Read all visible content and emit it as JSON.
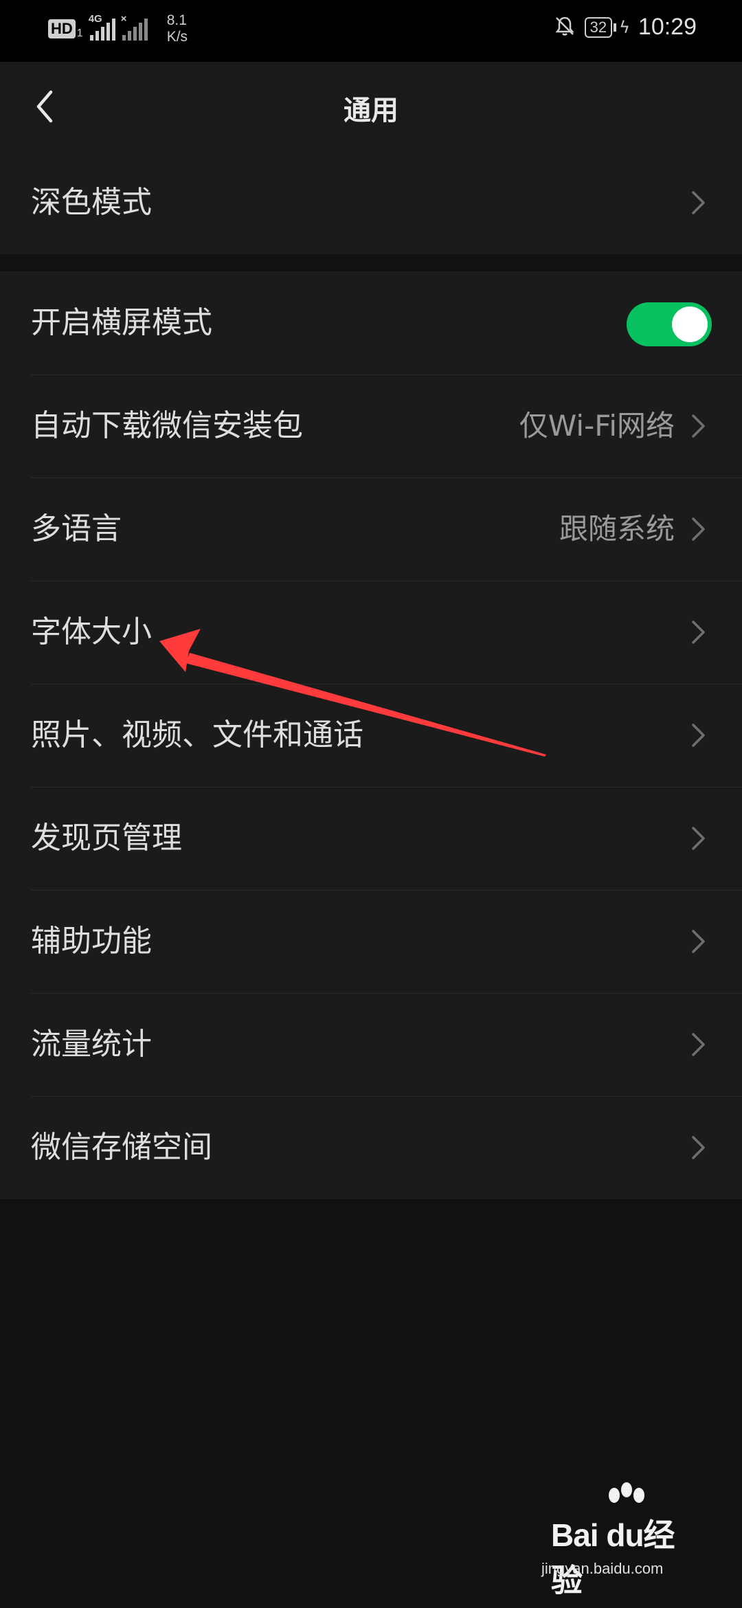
{
  "status_bar": {
    "hd_label": "HD",
    "sim_label": "1",
    "signal_tag_1": "4G",
    "signal_tag_2": "×",
    "speed_value": "8.1",
    "speed_unit": "K/s",
    "battery_level": "32",
    "time": "10:29"
  },
  "header": {
    "title": "通用"
  },
  "section1": {
    "items": [
      {
        "label": "深色模式",
        "value": ""
      }
    ]
  },
  "section2": {
    "landscape": {
      "label": "开启横屏模式",
      "enabled": true
    },
    "items": [
      {
        "label": "自动下载微信安装包",
        "value": "仅Wi-Fi网络"
      },
      {
        "label": "多语言",
        "value": "跟随系统"
      },
      {
        "label": "字体大小",
        "value": ""
      },
      {
        "label": "照片、视频、文件和通话",
        "value": ""
      },
      {
        "label": "发现页管理",
        "value": ""
      },
      {
        "label": "辅助功能",
        "value": ""
      },
      {
        "label": "流量统计",
        "value": ""
      },
      {
        "label": "微信存储空间",
        "value": ""
      }
    ]
  },
  "colors": {
    "toggle_on": "#07c160",
    "annotation_arrow": "#ff3b3b",
    "background": "#111111",
    "row_background": "#1b1b1b"
  },
  "watermark": {
    "logo_text": "Bai du经验",
    "site": "jingyan.baidu.com"
  }
}
